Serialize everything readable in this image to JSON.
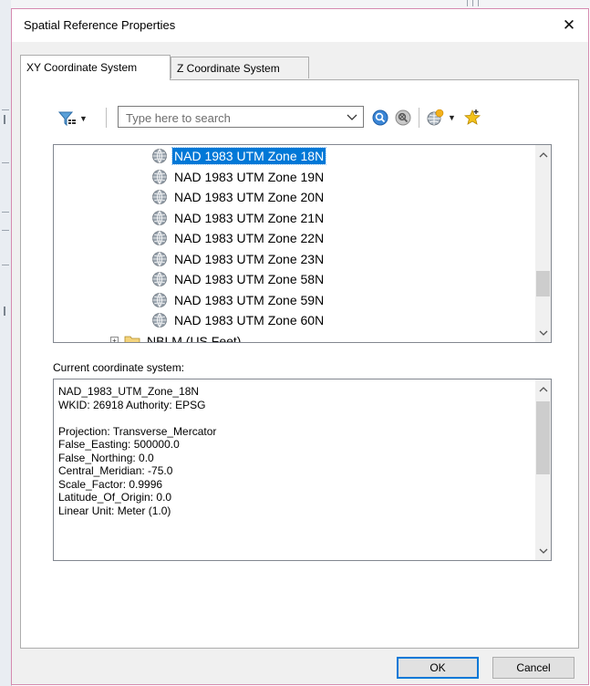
{
  "window": {
    "title": "Spatial Reference Properties",
    "close_glyph": "✕"
  },
  "tabs": [
    {
      "label": "XY Coordinate System",
      "active": true
    },
    {
      "label": "Z Coordinate System",
      "active": false
    }
  ],
  "toolbar": {
    "search_placeholder": "Type here to search",
    "icons": [
      "filter-icon",
      "search-icon",
      "clear-search-icon",
      "add-coordinate-system-icon",
      "favorite-star-icon"
    ]
  },
  "tree": {
    "items": [
      {
        "label": "NAD 1983 UTM Zone 18N",
        "selected": true
      },
      {
        "label": "NAD 1983 UTM Zone 19N",
        "selected": false
      },
      {
        "label": "NAD 1983 UTM Zone 20N",
        "selected": false
      },
      {
        "label": "NAD 1983 UTM Zone 21N",
        "selected": false
      },
      {
        "label": "NAD 1983 UTM Zone 22N",
        "selected": false
      },
      {
        "label": "NAD 1983 UTM Zone 23N",
        "selected": false
      },
      {
        "label": "NAD 1983 UTM Zone 58N",
        "selected": false
      },
      {
        "label": "NAD 1983 UTM Zone 59N",
        "selected": false
      },
      {
        "label": "NAD 1983 UTM Zone 60N",
        "selected": false
      }
    ],
    "partial_folder": "NBLM (US Feet)"
  },
  "current": {
    "label": "Current coordinate system:",
    "lines": [
      "NAD_1983_UTM_Zone_18N",
      "WKID: 26918 Authority: EPSG",
      "",
      "Projection: Transverse_Mercator",
      "False_Easting: 500000.0",
      "False_Northing: 0.0",
      "Central_Meridian: -75.0",
      "Scale_Factor: 0.9996",
      "Latitude_Of_Origin: 0.0",
      "Linear Unit: Meter (1.0)"
    ]
  },
  "buttons": {
    "ok": "OK",
    "cancel": "Cancel"
  },
  "colors": {
    "selection": "#0078d7",
    "dialog_border": "#d58ab0"
  }
}
